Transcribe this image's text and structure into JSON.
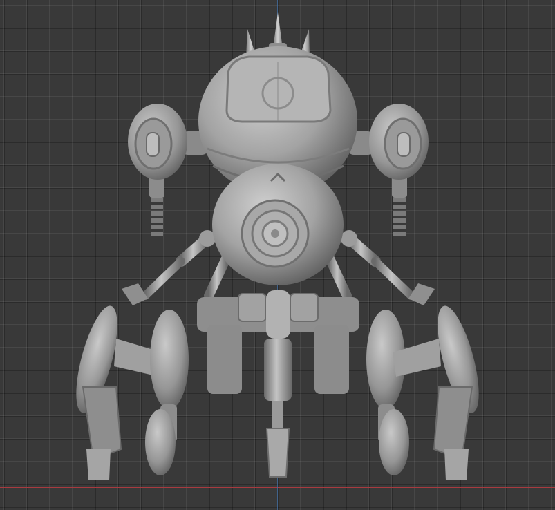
{
  "viewport": {
    "background_color": "#393939",
    "grid_color": "#454545",
    "x_axis_color": "#a83a3f",
    "y_axis_color": "#3f6fa8"
  },
  "model": {
    "material_color": "#a8a8a8",
    "shadow_color": "#6e6e6e",
    "highlight_color": "#d4d4d4"
  }
}
